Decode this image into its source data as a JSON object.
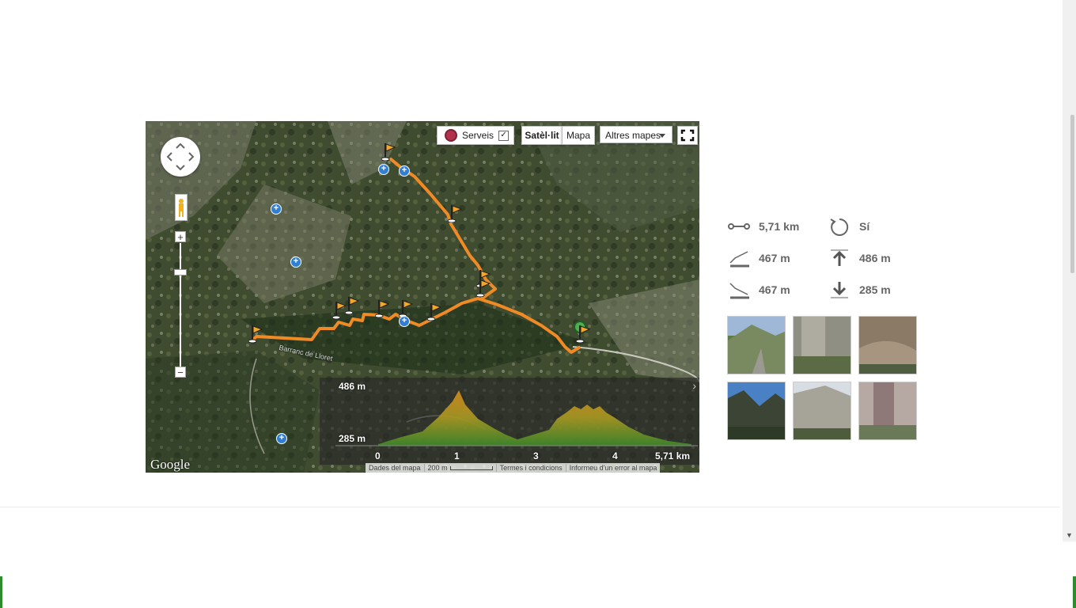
{
  "map": {
    "services_label": "Serveis",
    "services_checked": true,
    "satellite_label": "Satèl·lit",
    "map_label": "Mapa",
    "other_maps_label": "Altres mapes",
    "logo_text": "Google",
    "stream_label": "Barranc de Lloret",
    "elevation": {
      "max_label": "486 m",
      "min_label": "285 m",
      "x_ticks": [
        "0",
        "1",
        "3",
        "4",
        "5,71 km"
      ]
    },
    "attribution": {
      "map_data": "Dades del mapa",
      "scale": "200 m",
      "terms": "Termes i condicions",
      "report": "Informeu d'un error al mapa"
    },
    "icons": {
      "pan": "pan-control-icon",
      "pegman": "pegman-icon",
      "fullscreen": "fullscreen-icon",
      "waypoint": "flag-icon",
      "poi": "poi-plus-icon"
    }
  },
  "stats": {
    "distance": "5,71 km",
    "loop": "Sí",
    "max_altitude": "467 m",
    "elevation_gain": "486 m",
    "min_altitude": "467 m",
    "elevation_loss": "285 m"
  },
  "colors": {
    "route": "#f08a24",
    "elevation_fill": "#b5a42a",
    "stat_text": "#666666"
  }
}
